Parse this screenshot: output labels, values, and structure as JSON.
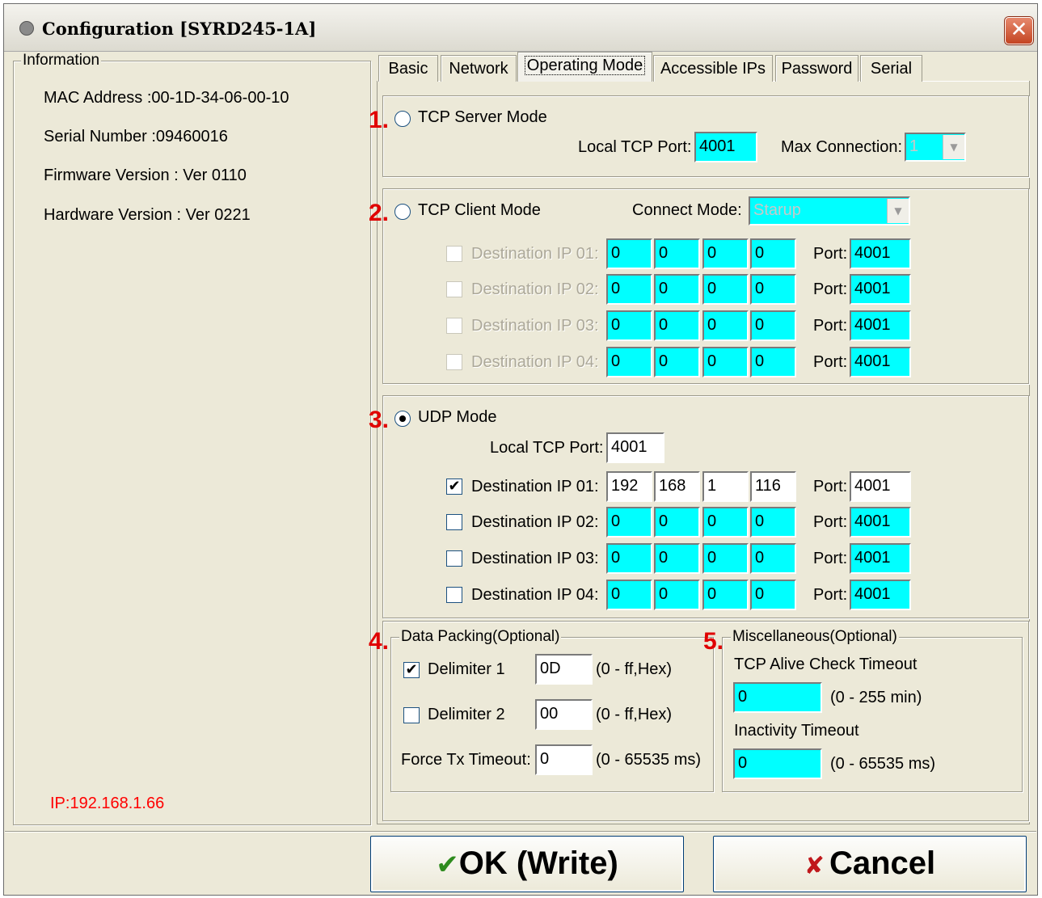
{
  "window": {
    "title": "Configuration [SYRD245-1A]",
    "close_glyph": "✕"
  },
  "info": {
    "legend": "Information",
    "mac": "MAC Address :00-1D-34-06-00-10",
    "serial": "Serial Number :09460016",
    "firmware": "Firmware Version : Ver 0110",
    "hardware": "Hardware Version : Ver 0221",
    "ip": "IP:192.168.1.66"
  },
  "tabs": [
    "Basic",
    "Network",
    "Operating Mode",
    "Accessible IPs",
    "Password",
    "Serial"
  ],
  "active_tab": "Operating Mode",
  "markers": [
    "1.",
    "2.",
    "3.",
    "4.",
    "5."
  ],
  "tcp_server": {
    "label": "TCP Server Mode",
    "selected": false,
    "local_port_label": "Local TCP Port:",
    "local_port": "4001",
    "max_conn_label": "Max Connection:",
    "max_conn": "1"
  },
  "tcp_client": {
    "label": "TCP Client  Mode",
    "selected": false,
    "connect_mode_label": "Connect Mode:",
    "connect_mode": "Starup",
    "dest_labels": [
      "Destination IP 01:",
      "Destination IP 02:",
      "Destination IP 03:",
      "Destination IP 04:"
    ],
    "port_label": "Port:",
    "rows": [
      {
        "checked": false,
        "ip": [
          "0",
          "0",
          "0",
          "0"
        ],
        "port": "4001"
      },
      {
        "checked": false,
        "ip": [
          "0",
          "0",
          "0",
          "0"
        ],
        "port": "4001"
      },
      {
        "checked": false,
        "ip": [
          "0",
          "0",
          "0",
          "0"
        ],
        "port": "4001"
      },
      {
        "checked": false,
        "ip": [
          "0",
          "0",
          "0",
          "0"
        ],
        "port": "4001"
      }
    ]
  },
  "udp": {
    "label": "UDP  Mode",
    "selected": true,
    "local_port_label": "Local TCP Port:",
    "local_port": "4001",
    "dest_labels": [
      "Destination IP 01:",
      "Destination IP 02:",
      "Destination IP 03:",
      "Destination IP 04:"
    ],
    "port_label": "Port:",
    "rows": [
      {
        "checked": true,
        "ip": [
          "192",
          "168",
          "1",
          "116"
        ],
        "port": "4001"
      },
      {
        "checked": false,
        "ip": [
          "0",
          "0",
          "0",
          "0"
        ],
        "port": "4001"
      },
      {
        "checked": false,
        "ip": [
          "0",
          "0",
          "0",
          "0"
        ],
        "port": "4001"
      },
      {
        "checked": false,
        "ip": [
          "0",
          "0",
          "0",
          "0"
        ],
        "port": "4001"
      }
    ]
  },
  "packing": {
    "legend": "Data Packing(Optional)",
    "delim1_label": "Delimiter 1",
    "delim1_checked": true,
    "delim1": "0D",
    "delim2_label": "Delimiter 2",
    "delim2_checked": false,
    "delim2": "00",
    "hex_range": "(0 - ff,Hex)",
    "force_label": "Force Tx Timeout:",
    "force": "0",
    "force_range": "(0 - 65535 ms)"
  },
  "misc": {
    "legend": "Miscellaneous(Optional)",
    "alive_label": "TCP Alive Check Timeout",
    "alive": "0",
    "alive_range": "(0 - 255 min)",
    "inactivity_label": "Inactivity Timeout",
    "inactivity": "0",
    "inactivity_range": "(0 - 65535 ms)"
  },
  "buttons": {
    "ok_icon": "✔",
    "ok": "OK (Write)",
    "cancel_icon": "✘",
    "cancel": "Cancel"
  },
  "colors": {
    "field_cyan": "#00ffff",
    "marker_red": "#e00000",
    "ip_red": "#ff0000",
    "ok_green": "#2e8b1e",
    "cancel_red": "#c0181c"
  }
}
